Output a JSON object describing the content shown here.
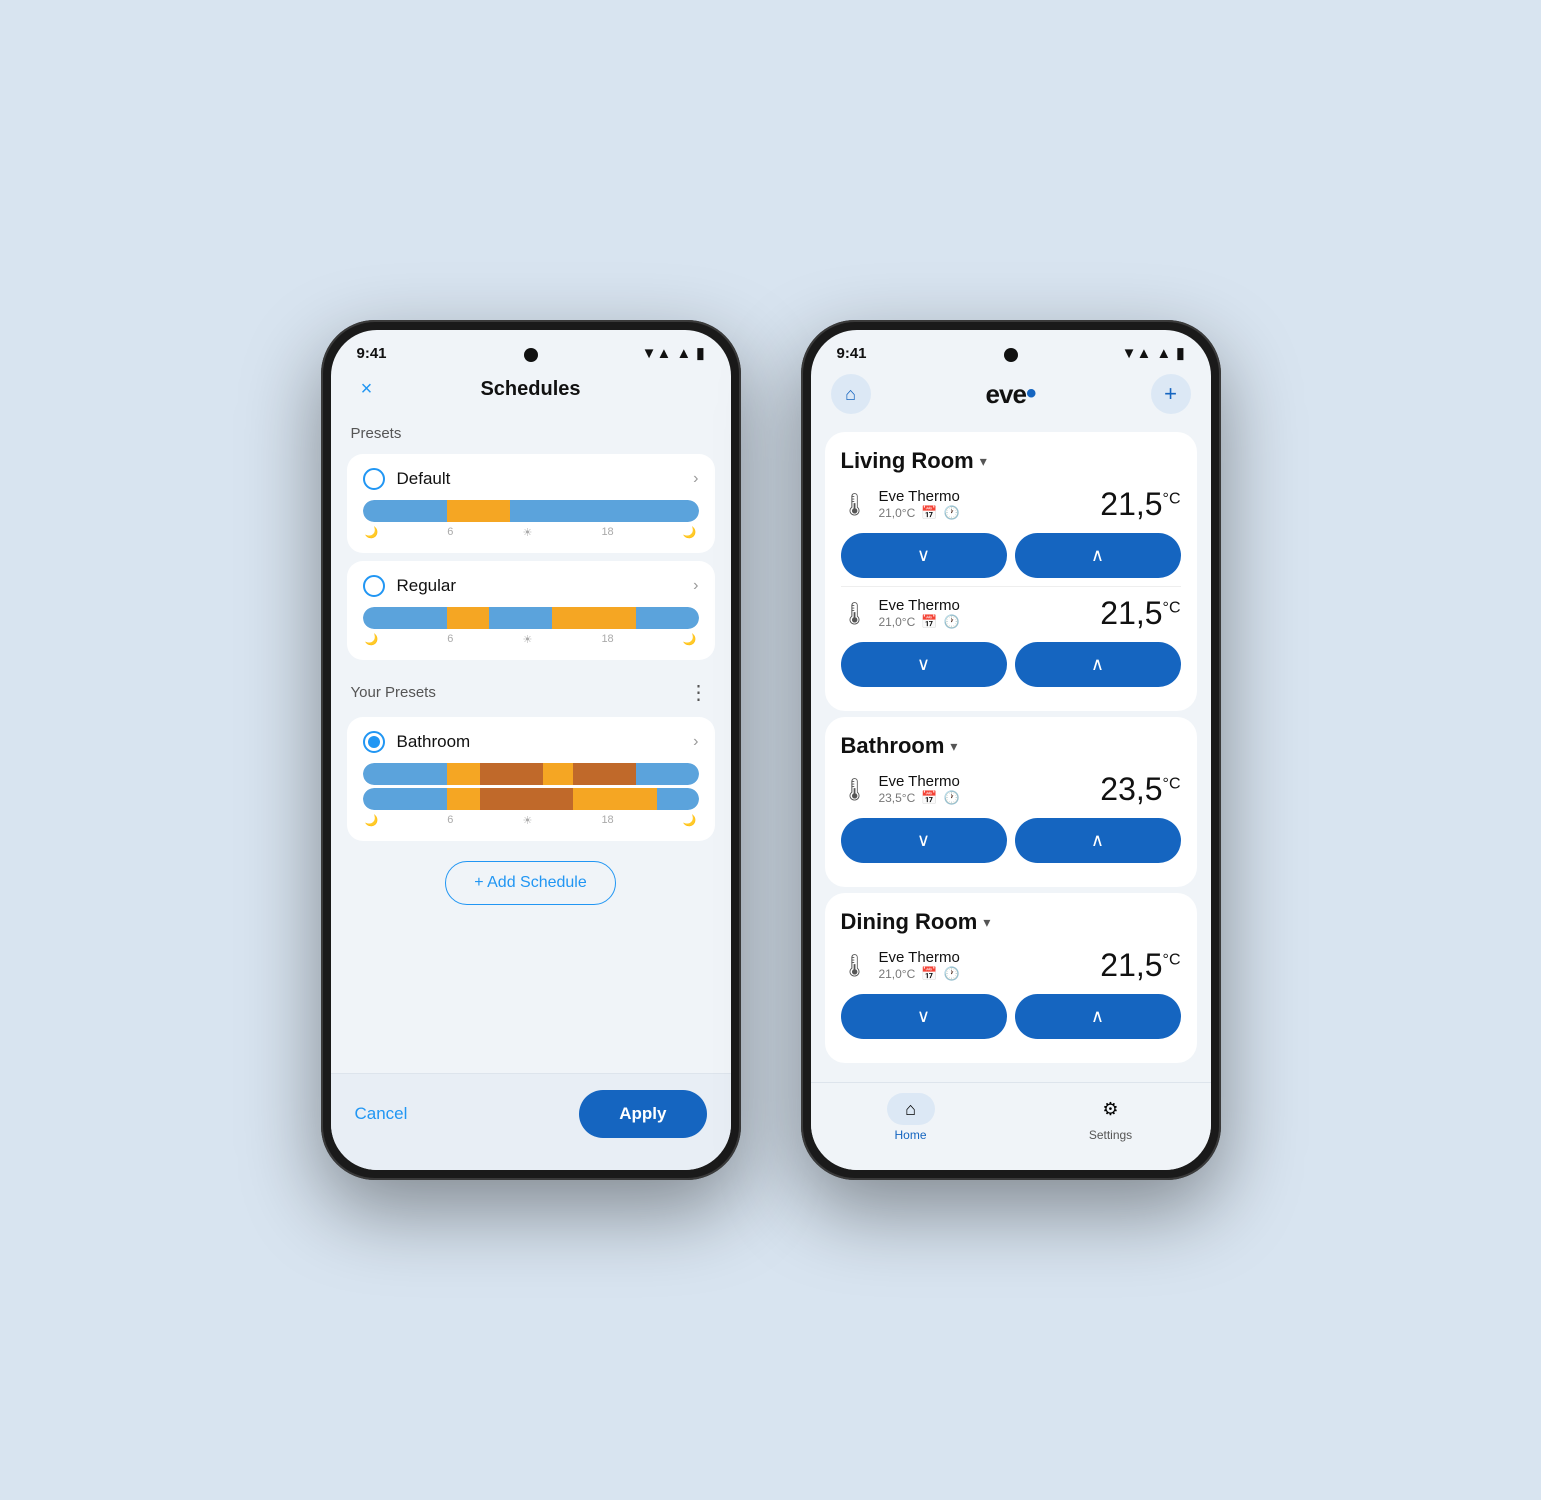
{
  "phone1": {
    "statusBar": {
      "time": "9:41",
      "wifiIcon": "▼▲",
      "signalIcon": "▲",
      "batteryIcon": "🔋"
    },
    "header": {
      "closeLabel": "×",
      "title": "Schedules"
    },
    "presetsLabel": "Presets",
    "presets": [
      {
        "name": "Default",
        "selected": false,
        "bars": [
          {
            "color": "#5BA3DC",
            "flex": 2
          },
          {
            "color": "#F5A623",
            "flex": 1.5
          },
          {
            "color": "#5BA3DC",
            "flex": 2.5
          },
          {
            "color": "#5BA3DC",
            "flex": 2
          }
        ],
        "timeLabels": [
          "🌙",
          "6",
          "☀",
          "18",
          "🌙"
        ]
      },
      {
        "name": "Regular",
        "selected": false,
        "bars": [
          {
            "color": "#5BA3DC",
            "flex": 2
          },
          {
            "color": "#F5A623",
            "flex": 1
          },
          {
            "color": "#5BA3DC",
            "flex": 1.5
          },
          {
            "color": "#F5A623",
            "flex": 2
          },
          {
            "color": "#5BA3DC",
            "flex": 1.5
          }
        ],
        "timeLabels": [
          "🌙",
          "6",
          "☀",
          "18",
          "🌙"
        ]
      }
    ],
    "yourPresetsLabel": "Your Presets",
    "yourPresets": [
      {
        "name": "Bathroom",
        "selected": true,
        "bars": [
          {
            "color": "#5BA3DC",
            "flex": 2
          },
          {
            "color": "#F5A623",
            "flex": 1
          },
          {
            "color": "#c0692a",
            "flex": 1.5
          },
          {
            "color": "#F5A623",
            "flex": 1
          },
          {
            "color": "#c0692a",
            "flex": 1.5
          },
          {
            "color": "#5BA3DC",
            "flex": 1
          }
        ],
        "bars2": [
          {
            "color": "#5BA3DC",
            "flex": 2
          },
          {
            "color": "#F5A623",
            "flex": 1
          },
          {
            "color": "#c0692a",
            "flex": 2
          },
          {
            "color": "#F5A623",
            "flex": 2
          },
          {
            "color": "#5BA3DC",
            "flex": 1
          }
        ],
        "timeLabels": [
          "🌙",
          "6",
          "☀",
          "18",
          "🌙"
        ]
      }
    ],
    "addScheduleLabel": "+ Add Schedule",
    "cancelLabel": "Cancel",
    "applyLabel": "Apply"
  },
  "phone2": {
    "statusBar": {
      "time": "9:41"
    },
    "header": {
      "homeIcon": "⌂",
      "logo": "eve",
      "logoDot": "•",
      "addIcon": "+"
    },
    "rooms": [
      {
        "name": "Living Room",
        "chevron": "▾",
        "devices": [
          {
            "name": "Eve Thermo",
            "subTemp": "21,0°C",
            "temp": "21,5",
            "tempUnit": "°C"
          },
          {
            "name": "Eve Thermo",
            "subTemp": "21,0°C",
            "temp": "21,5",
            "tempUnit": "°C"
          }
        ]
      },
      {
        "name": "Bathroom",
        "chevron": "▾",
        "devices": [
          {
            "name": "Eve Thermo",
            "subTemp": "23,5°C",
            "temp": "23,5",
            "tempUnit": "°C"
          }
        ]
      },
      {
        "name": "Dining Room",
        "chevron": "▾",
        "devices": [
          {
            "name": "Eve Thermo",
            "subTemp": "21,0°C",
            "temp": "21,5",
            "tempUnit": "°C"
          }
        ]
      }
    ],
    "nav": [
      {
        "icon": "⌂",
        "label": "Home",
        "active": true
      },
      {
        "icon": "⚙",
        "label": "Settings",
        "active": false
      }
    ]
  }
}
